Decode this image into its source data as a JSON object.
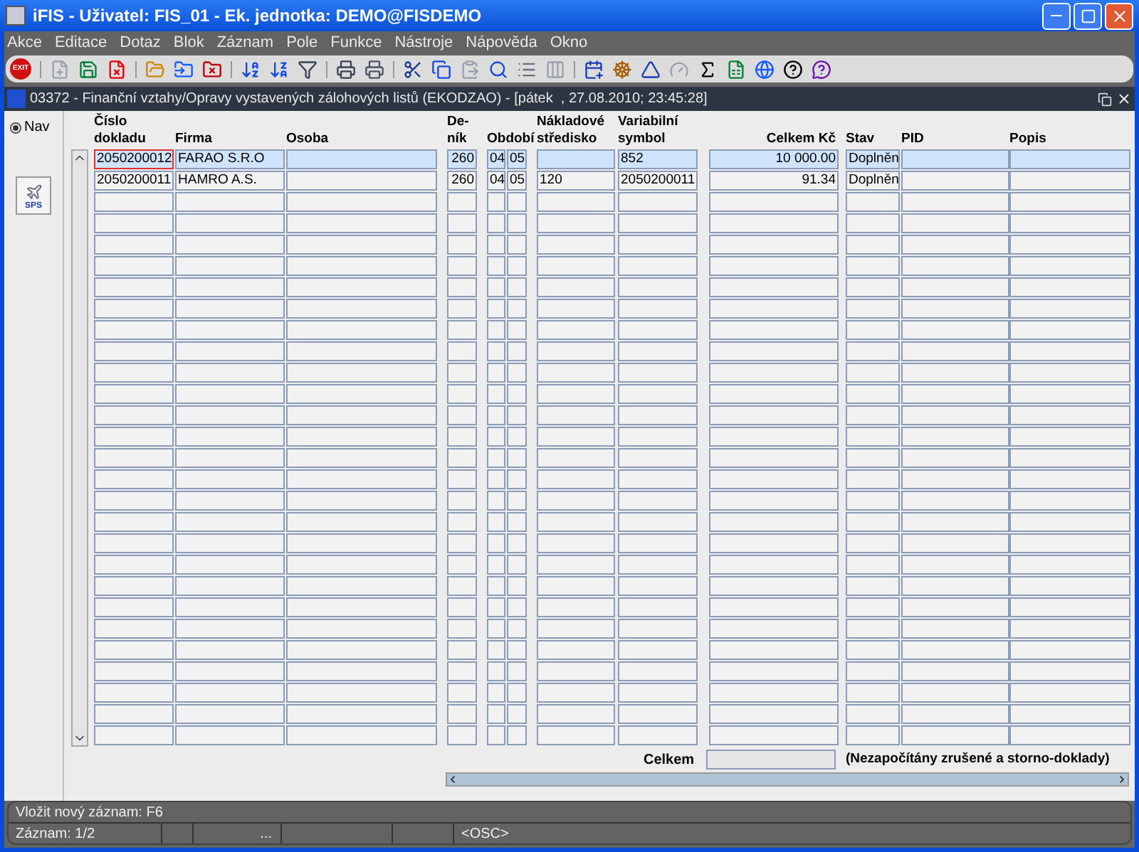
{
  "window": {
    "title": "iFIS - Uživatel: FIS_01 - Ek. jednotka: DEMO@FISDEMO"
  },
  "menu": [
    "Akce",
    "Editace",
    "Dotaz",
    "Blok",
    "Záznam",
    "Pole",
    "Funkce",
    "Nástroje",
    "Nápověda",
    "Okno"
  ],
  "toolbar": {
    "exit_label": "EXIT"
  },
  "form": {
    "title": "03372 - Finanční vztahy/Opravy vystavených zálohových listů (EKODZAO) - [pátek  , 27.08.2010; 23:45:28]"
  },
  "nav": {
    "label": "Nav",
    "selected": true
  },
  "sps_button": {
    "label": "SPS"
  },
  "table": {
    "columns": [
      "Číslo\ndokladu",
      "Firma",
      "Osoba",
      "De-\nník",
      "Období",
      "Nákladové\nstředisko",
      "Variabilní\nsymbol",
      "Celkem Kč",
      "Stav",
      "PID",
      "Popis"
    ],
    "rows": [
      {
        "selected": true,
        "cells": [
          "2050200012",
          "FARAO S.R.O",
          "",
          "260",
          [
            "04",
            "05"
          ],
          "",
          "852",
          "10 000.00",
          "Doplněn",
          "",
          ""
        ]
      },
      {
        "selected": false,
        "cells": [
          "2050200011",
          "HAMRO A.S.",
          "",
          "260",
          [
            "04",
            "05"
          ],
          "120",
          "2050200011",
          "91.34",
          "Doplněn",
          "",
          ""
        ]
      }
    ]
  },
  "total": {
    "label": "Celkem",
    "note": "(Nezapočítány zrušené a storno-doklady)"
  },
  "status_bar": {
    "hint": "Vložit nový záznam: F6",
    "record": "Záznam: 1/2",
    "segment": "...",
    "mode": "<OSC>"
  }
}
